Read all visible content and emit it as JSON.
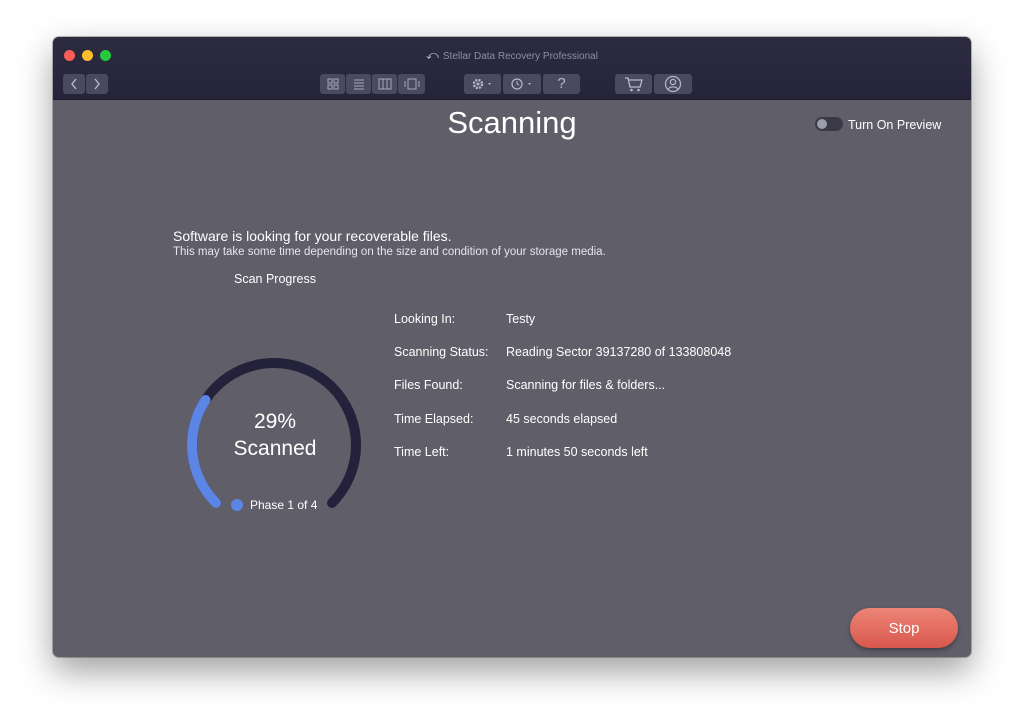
{
  "window": {
    "title": "Stellar Data Recovery Professional"
  },
  "toolbar": {
    "nav_back_icon": "chevron-left-icon",
    "nav_forward_icon": "chevron-right-icon",
    "view_icons": [
      "grid-view-icon",
      "list-view-icon",
      "column-view-icon",
      "coverflow-view-icon"
    ],
    "help_label": "?",
    "icons": [
      "gear-icon",
      "history-icon",
      "help-icon",
      "cart-icon",
      "user-icon"
    ]
  },
  "page": {
    "heading": "Scanning",
    "preview_toggle_label": "Turn On Preview",
    "preview_on": false
  },
  "status": {
    "message": "Software is looking for your recoverable files.",
    "submessage": "This may take some time depending on the size and condition of your storage media."
  },
  "progress": {
    "title": "Scan Progress",
    "percent": 29,
    "percent_text": "29%",
    "scanned_label": "Scanned",
    "phase_text": "Phase 1 of 4"
  },
  "details": [
    {
      "label": "Looking In:",
      "value": "Testy"
    },
    {
      "label": "Scanning Status:",
      "value": "Reading Sector 39137280 of 133808048"
    },
    {
      "label": "Files Found:",
      "value": "Scanning for files & folders..."
    },
    {
      "label": "Time Elapsed:",
      "value": "45 seconds elapsed"
    },
    {
      "label": "Time Left:",
      "value": "1 minutes 50 seconds left"
    }
  ],
  "actions": {
    "stop_label": "Stop"
  },
  "colors": {
    "accent": "#5c86e6",
    "track": "#23223a",
    "stop": "#e1665a",
    "background": "#5f5e69"
  }
}
